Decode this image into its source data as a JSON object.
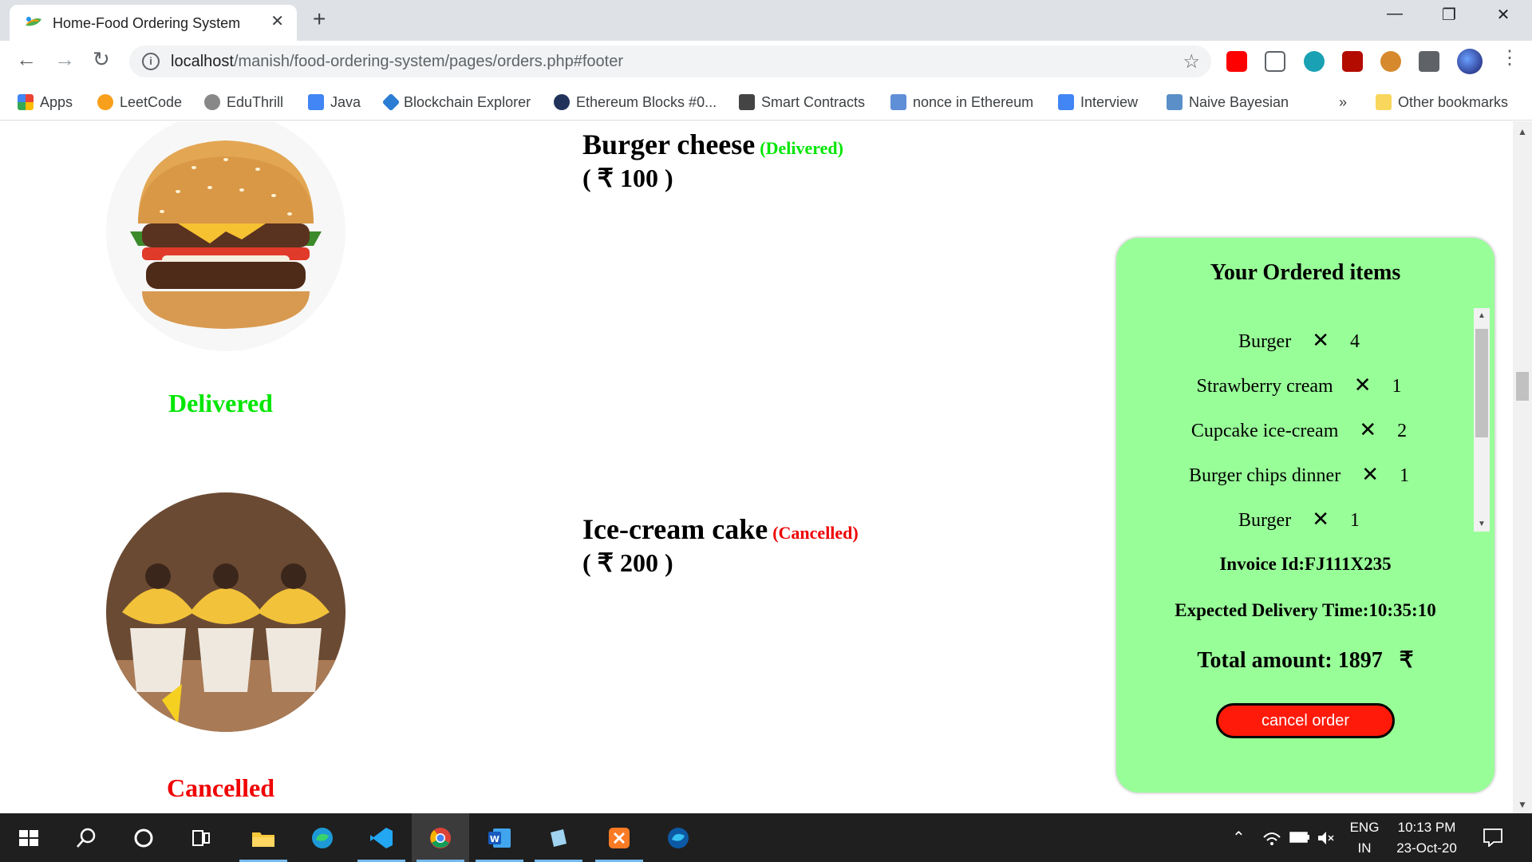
{
  "browser": {
    "tab_title": "Home-Food Ordering System",
    "url_host": "localhost",
    "url_path": "/manish/food-ordering-system/pages/orders.php#footer",
    "bookmarks": [
      {
        "label": "Apps",
        "icon": "apps-grid-icon"
      },
      {
        "label": "LeetCode",
        "icon": "leetcode-icon"
      },
      {
        "label": "EduThrill",
        "icon": "eduthrill-icon"
      },
      {
        "label": "Java",
        "icon": "doc-icon"
      },
      {
        "label": "Blockchain Explorer",
        "icon": "blockchain-icon"
      },
      {
        "label": "Ethereum Blocks #0...",
        "icon": "etherscan-icon"
      },
      {
        "label": "Smart Contracts",
        "icon": "book-icon"
      },
      {
        "label": "nonce in Ethereum",
        "icon": "eth-icon"
      },
      {
        "label": "Interview",
        "icon": "doc-icon"
      },
      {
        "label": "Naive Bayesian",
        "icon": "naive-icon"
      }
    ],
    "more_bookmarks": "»",
    "other_bookmarks": "Other bookmarks"
  },
  "orders": [
    {
      "name": "Burger cheese",
      "status": "(Delivered)",
      "status_label": "Delivered",
      "price": "( ₹ 100 )",
      "status_color": "#00e600"
    },
    {
      "name": "Ice-cream cake",
      "status": "(Cancelled)",
      "status_label": "Cancelled",
      "price": "( ₹ 200 )",
      "status_color": "#f00000"
    }
  ],
  "panel": {
    "title": "Your Ordered items",
    "items": [
      {
        "name": "Burger",
        "qty": "4"
      },
      {
        "name": "Strawberry cream",
        "qty": "1"
      },
      {
        "name": "Cupcake ice-cream",
        "qty": "2"
      },
      {
        "name": "Burger chips dinner",
        "qty": "1"
      },
      {
        "name": "Burger",
        "qty": "1"
      }
    ],
    "times_symbol": "✕",
    "invoice": "Invoice Id:FJ111X235",
    "delivery": "Expected Delivery Time:10:35:10",
    "total": "Total amount: 1897",
    "currency": "₹",
    "cancel_label": "cancel order",
    "panel_color": "#98ff98",
    "button_color": "#ff1a0a"
  },
  "taskbar": {
    "lang_top": "ENG",
    "lang_bottom": "IN",
    "time": "10:13 PM",
    "date": "23-Oct-20"
  }
}
